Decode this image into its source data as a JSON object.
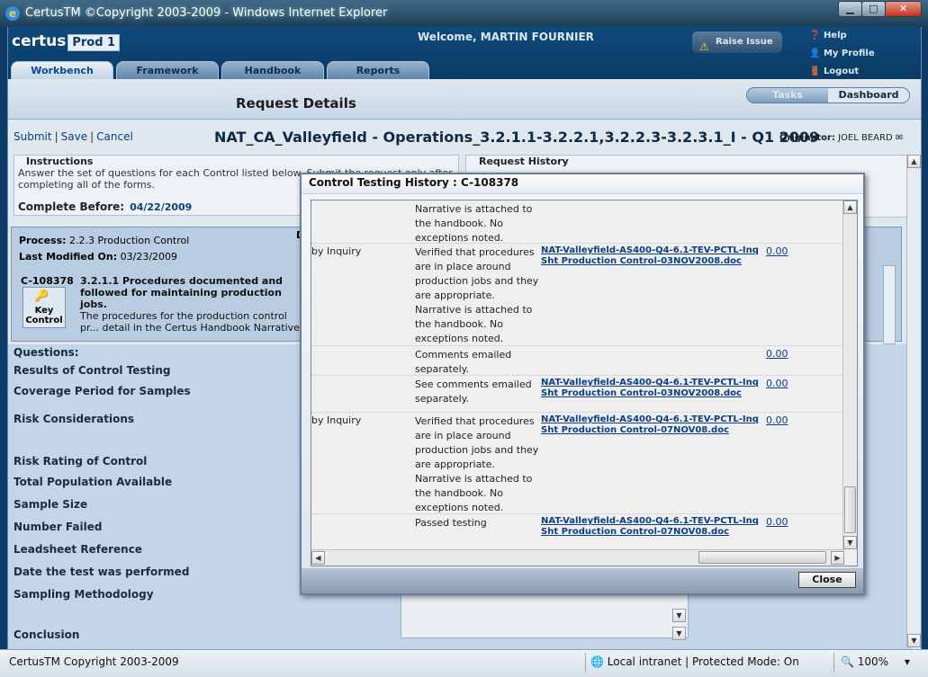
{
  "window": {
    "title": "CertusTM ©Copyright 2003-2009 - Windows Internet Explorer",
    "minimize": "▁",
    "maximize": "□",
    "close": "✕"
  },
  "header": {
    "logo": "certus",
    "env": "Prod 1",
    "welcome": "Welcome, MARTIN FOURNIER",
    "raise_issue": "Raise Issue",
    "links": [
      "Help",
      "My Profile",
      "Logout"
    ]
  },
  "tabs": [
    "Workbench",
    "Framework",
    "Handbook",
    "Reports"
  ],
  "page_title": "Request Details",
  "subtabs": [
    "Tasks",
    "Dashboard"
  ],
  "actions": [
    "Submit",
    "Save",
    "Cancel"
  ],
  "record_title": "NAT_CA_Valleyfield - Operations_3.2.1.1-3.2.2.1,3.2.2.3-3.2.3.1_I - Q1 2009",
  "originator": {
    "label": "Originator:",
    "name": "JOEL BEARD"
  },
  "instructions": {
    "label": "Instructions",
    "text": "Answer the set of questions for each Control listed below. Submit the request only after completing all of the forms.",
    "complete_label": "Complete Before:",
    "complete_date": "04/22/2009"
  },
  "request_history": {
    "label": "Request History"
  },
  "process": {
    "process_label": "Process:",
    "process_value": "2.2.3 Production Control",
    "modified_label": "Last Modified On:",
    "modified_value": "03/23/2009",
    "control_id": "C-108378",
    "control_title": "3.2.1.1 Procedures documented and followed for maintaining production jobs.",
    "control_desc": "The procedures for the production control pr... detail in the Certus Handbook Narrative.",
    "key_control": "Key Control",
    "col_d": "D"
  },
  "questions": {
    "header": "Questions:",
    "items": [
      "Results of Control Testing",
      "Coverage Period for Samples",
      "Risk Considerations",
      "Risk Rating of Control",
      "Total Population Available",
      "Sample Size",
      "Number Failed",
      "Leadsheet Reference",
      "Date the test was performed",
      "Sampling Methodology",
      "Conclusion"
    ]
  },
  "modal": {
    "title": "Control Testing History : C-108378",
    "rows": [
      {
        "method": "",
        "comment": "Narrative is attached to the handbook. No exceptions noted.",
        "doc": "",
        "value": ""
      },
      {
        "method": "by Inquiry",
        "comment": "Verified that procedures are in place around production jobs and they are appropriate. Narrative is attached to the handbook. No exceptions noted.",
        "doc": "NAT-Valleyfield-AS400-Q4-6.1-TEV-PCTL-Inq Sht Production Control-03NOV2008.doc",
        "value": "0.00"
      },
      {
        "method": "",
        "comment": "Comments emailed separately.",
        "doc": "",
        "value": "0.00"
      },
      {
        "method": "",
        "comment": "See comments emailed separately.",
        "doc": "NAT-Valleyfield-AS400-Q4-6.1-TEV-PCTL-Inq Sht Production Control-03NOV2008.doc",
        "value": "0.00"
      },
      {
        "method": "by Inquiry",
        "comment": "Verified that procedures are in place around production jobs and they are appropriate. Narrative is attached to the handbook. No exceptions noted.",
        "doc": "NAT-Valleyfield-AS400-Q4-6.1-TEV-PCTL-Inq Sht Production Control-07NOV08.doc",
        "value": "0.00"
      },
      {
        "method": "",
        "comment": "Passed testing",
        "doc": "NAT-Valleyfield-AS400-Q4-6.1-TEV-PCTL-Inq Sht Production Control-07NOV08.doc",
        "value": "0.00"
      }
    ],
    "close": "Close"
  },
  "statusbar": {
    "left": "CertusTM Copyright 2003-2009",
    "zone": "Local intranet | Protected Mode: On",
    "zoom": "100%"
  }
}
